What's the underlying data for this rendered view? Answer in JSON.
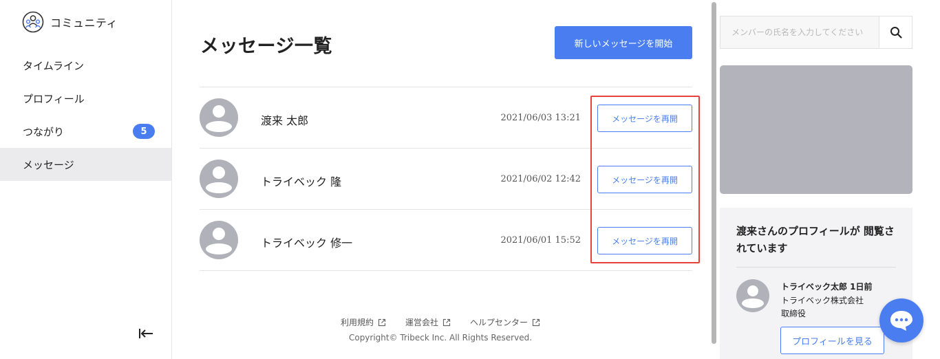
{
  "app": {
    "name": "コミュニティ"
  },
  "sidebar": {
    "items": [
      {
        "label": "タイムライン"
      },
      {
        "label": "プロフィール"
      },
      {
        "label": "つながり",
        "badge": "5"
      },
      {
        "label": "メッセージ",
        "active": true
      }
    ]
  },
  "main": {
    "title": "メッセージ一覧",
    "new_message_button": "新しいメッセージを開始",
    "messages": [
      {
        "name": "渡来 太郎",
        "date": "2021/06/03 13:21",
        "action": "メッセージを再開"
      },
      {
        "name": "トライベック 隆",
        "date": "2021/06/02 12:42",
        "action": "メッセージを再開"
      },
      {
        "name": "トライベック 修一",
        "date": "2021/06/01 15:52",
        "action": "メッセージを再開"
      }
    ]
  },
  "footer": {
    "links": [
      "利用規約",
      "運営会社",
      "ヘルプセンター"
    ],
    "copyright": "Copyright© Tribeck Inc. All Rights Reserved."
  },
  "right_panel": {
    "search": {
      "placeholder": "メンバーの氏名を入力してください"
    },
    "viewers": {
      "title": "渡来さんのプロフィールが 閲覧されています",
      "viewer": {
        "name": "トライベック太郎 1日前",
        "company": "トライベック株式会社",
        "role": "取締役",
        "button": "プロフィールを見る"
      }
    }
  },
  "colors": {
    "accent": "#4a7ef0",
    "highlight": "#e8403a",
    "avatar": "#b0b1b9"
  }
}
